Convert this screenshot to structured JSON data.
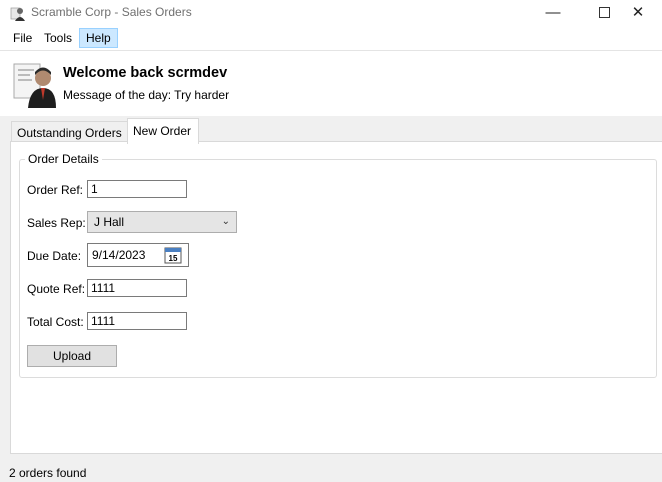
{
  "window": {
    "title": "Scramble Corp - Sales Orders",
    "icons": {
      "app": "app-icon",
      "minimize": "minimize-icon",
      "maximize": "maximize-icon",
      "close": "close-icon"
    }
  },
  "menu": {
    "file": "File",
    "tools": "Tools",
    "help": "Help"
  },
  "header": {
    "welcome": "Welcome back scrmdev",
    "motd": "Message of the day: Try harder",
    "avatar_icon": "user-avatar-icon"
  },
  "tabs": [
    {
      "label": "Outstanding Orders",
      "selected": false
    },
    {
      "label": "New Order",
      "selected": true
    }
  ],
  "order_details": {
    "group_title": "Order Details",
    "order_ref_label": "Order Ref:",
    "order_ref_value": "1",
    "sales_rep_label": "Sales Rep:",
    "sales_rep_value": "J Hall",
    "due_date_label": "Due Date:",
    "due_date_value": "9/14/2023",
    "calendar_day": "15",
    "quote_ref_label": "Quote Ref:",
    "quote_ref_value": "1111",
    "total_cost_label": "Total Cost:",
    "total_cost_value": "1111",
    "upload_label": "Upload"
  },
  "status": {
    "text": "2 orders found"
  },
  "colors": {
    "menu_highlight": "#cce8ff",
    "window_background": "#f0f0f0",
    "panel_background": "#ffffff"
  }
}
